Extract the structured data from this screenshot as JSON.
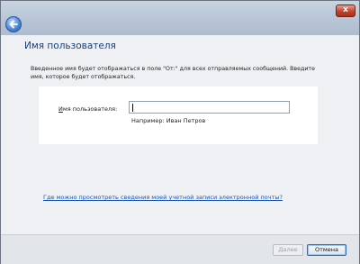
{
  "window": {
    "close_glyph": "x"
  },
  "page": {
    "heading": "Имя пользователя",
    "description": "Введенное имя будет отображаться в поле \"От:\" для всех отправляемых сообщений. Введите имя, которое будет отображаться.",
    "field_label_accel": "И",
    "field_label_rest": "мя пользователя:",
    "name_value": "",
    "hint": "Например: Иван Петров",
    "help_link": "Где можно просмотреть сведения моей учетной записи электронной почты?"
  },
  "footer": {
    "next_label": "Далее",
    "cancel_label": "Отмена"
  },
  "icons": {
    "back": "back-arrow-icon",
    "close": "close-icon"
  },
  "colors": {
    "heading": "#1a3f7a",
    "link": "#1b57b3",
    "titlebar": "#b7c5d6"
  }
}
